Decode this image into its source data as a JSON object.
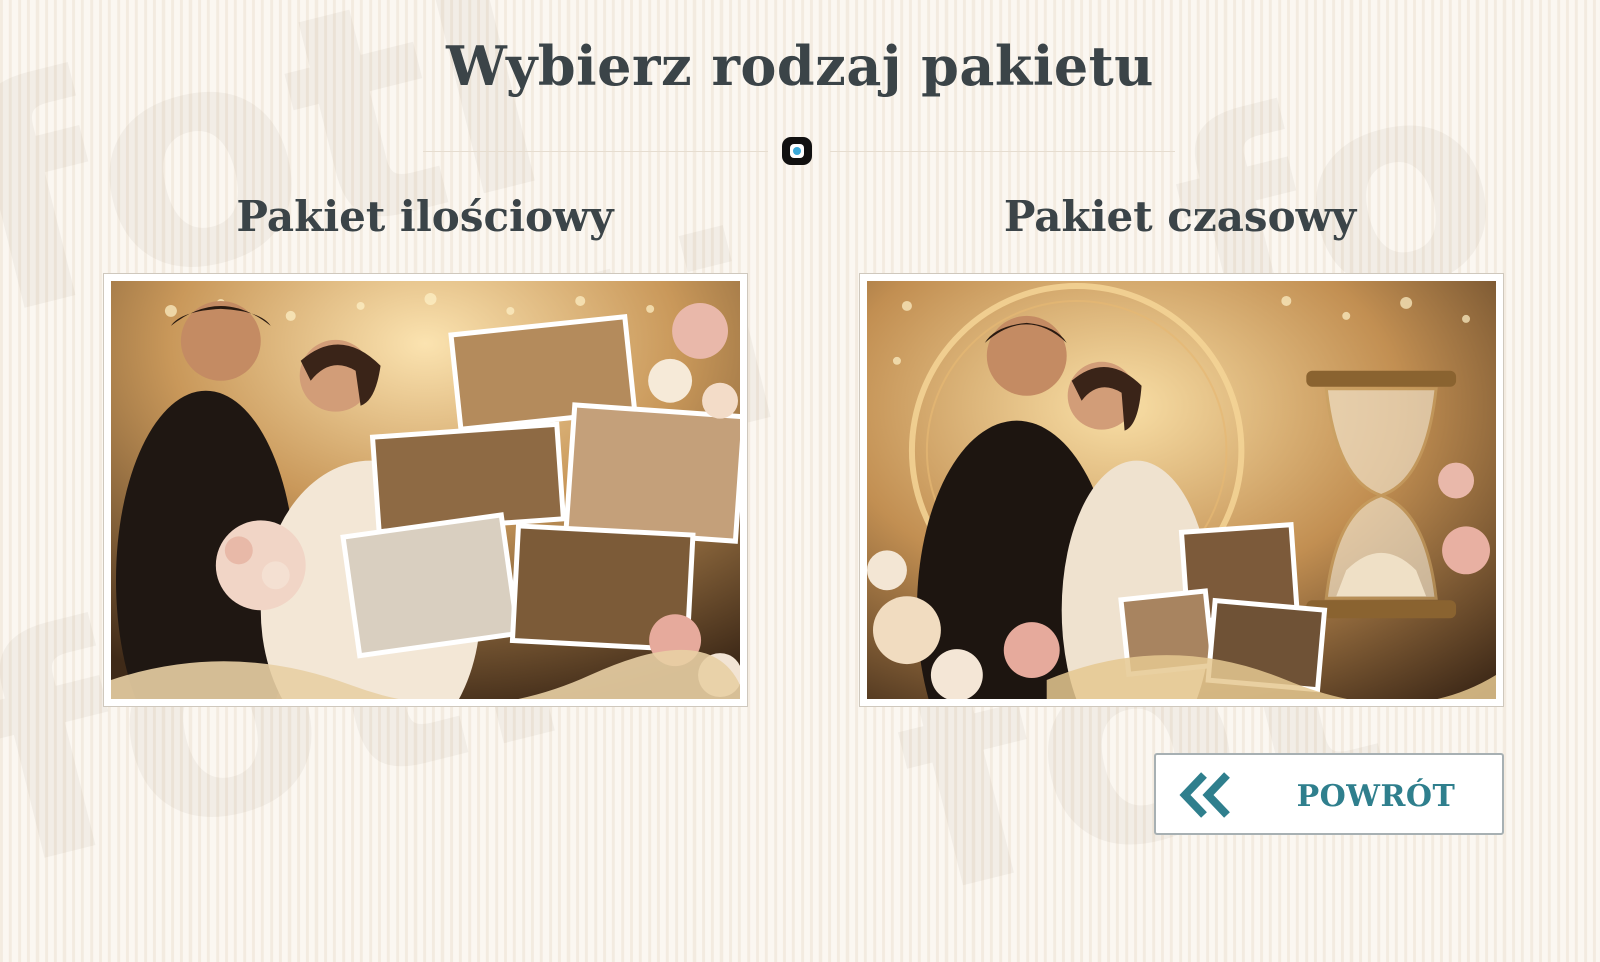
{
  "page": {
    "title": "Wybierz rodzaj pakietu"
  },
  "packages": [
    {
      "name": "Pakiet ilościowy",
      "photo_alt": "wedding-collage-quantity"
    },
    {
      "name": "Pakiet czasowy",
      "photo_alt": "wedding-collage-time"
    }
  ],
  "back_button": {
    "label": "POWRÓT",
    "icon": "double-chevron-left-icon"
  },
  "colors": {
    "heading": "#3b4448",
    "accent": "#2f7f8d",
    "background": "#faf5ee",
    "brand_lens": "#3aa9d8"
  }
}
